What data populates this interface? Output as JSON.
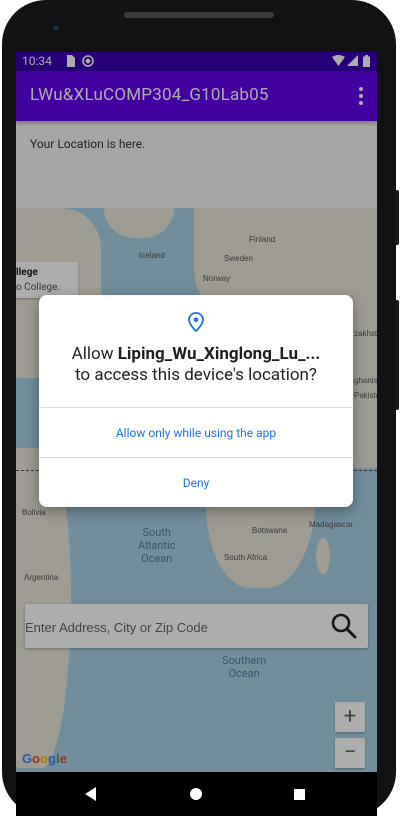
{
  "status_bar": {
    "time": "10:34"
  },
  "app_bar": {
    "title": "LWu&XLuCOMP304_G10Lab05"
  },
  "main": {
    "location_text": "Your Location is here."
  },
  "map": {
    "info_card": {
      "line1": "llege",
      "line2": "o College."
    },
    "labels": {
      "iceland": "Iceland",
      "finland": "Finland",
      "sweden": "Sweden",
      "norway": "Norway",
      "zakhstan": "zakhsta",
      "ghanistan": "ghanista",
      "pakistan": "Pakistan",
      "bolivia": "Bolivia",
      "argentina": "Argentina",
      "botswana": "Botswana",
      "madagascar": "Madagascar",
      "south_africa": "South Africa"
    },
    "oceans": {
      "south_atlantic": [
        "South",
        "Atlantic",
        "Ocean"
      ],
      "southern": [
        "Southern",
        "Ocean"
      ]
    },
    "zoom_in": "+",
    "zoom_out": "−",
    "google_logo": [
      "G",
      "o",
      "o",
      "g",
      "l",
      "e"
    ]
  },
  "search": {
    "placeholder": "Enter Address, City or Zip Code"
  },
  "dialog": {
    "prefix": "Allow ",
    "app_name": "Liping_Wu_Xinglong_Lu_...",
    "suffix": "to access this device's location?",
    "allow_label": "Allow only while using the app",
    "deny_label": "Deny"
  },
  "colors": {
    "status_bar": "#3700b3",
    "app_bar": "#6200ee",
    "dialog_button": "#1a73e8",
    "water": "#a9d2e6",
    "land": "#e9e6d9"
  },
  "icons": [
    "signal-icon",
    "sim-icon",
    "sync-icon",
    "wifi-icon",
    "cellular-icon",
    "battery-icon",
    "overflow-menu-icon",
    "location-pin-icon",
    "search-icon"
  ]
}
